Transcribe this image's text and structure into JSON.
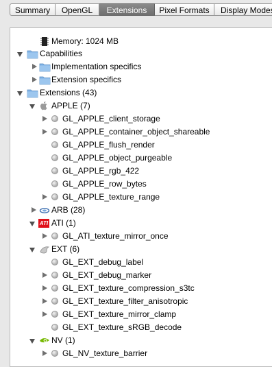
{
  "tabs": [
    {
      "label": "Summary"
    },
    {
      "label": "OpenGL"
    },
    {
      "label": "Extensions"
    },
    {
      "label": "Pixel Formats"
    },
    {
      "label": "Display Modes"
    }
  ],
  "active_tab": "Extensions",
  "tree": {
    "memory": "Memory: 1024 MB",
    "capabilities": "Capabilities",
    "implementation": "Implementation specifics",
    "extension_specifics": "Extension specifics",
    "extensions": "Extensions (43)",
    "apple": {
      "label": "APPLE (7)",
      "items": [
        "GL_APPLE_client_storage",
        "GL_APPLE_container_object_shareable",
        "GL_APPLE_flush_render",
        "GL_APPLE_object_purgeable",
        "GL_APPLE_rgb_422",
        "GL_APPLE_row_bytes",
        "GL_APPLE_texture_range"
      ]
    },
    "arb": {
      "label": "ARB (28)"
    },
    "ati": {
      "label": "ATI (1)",
      "logo_text": "ATI",
      "items": [
        "GL_ATI_texture_mirror_once"
      ]
    },
    "ext": {
      "label": "EXT (6)",
      "items": [
        "GL_EXT_debug_label",
        "GL_EXT_debug_marker",
        "GL_EXT_texture_compression_s3tc",
        "GL_EXT_texture_filter_anisotropic",
        "GL_EXT_texture_mirror_clamp",
        "GL_EXT_texture_sRGB_decode"
      ]
    },
    "nv": {
      "label": "NV (1)",
      "items": [
        "GL_NV_texture_barrier"
      ]
    }
  },
  "colors": {
    "folder": "#7fb2e5",
    "ati_red": "#e0101a",
    "nv_green": "#76b900"
  }
}
